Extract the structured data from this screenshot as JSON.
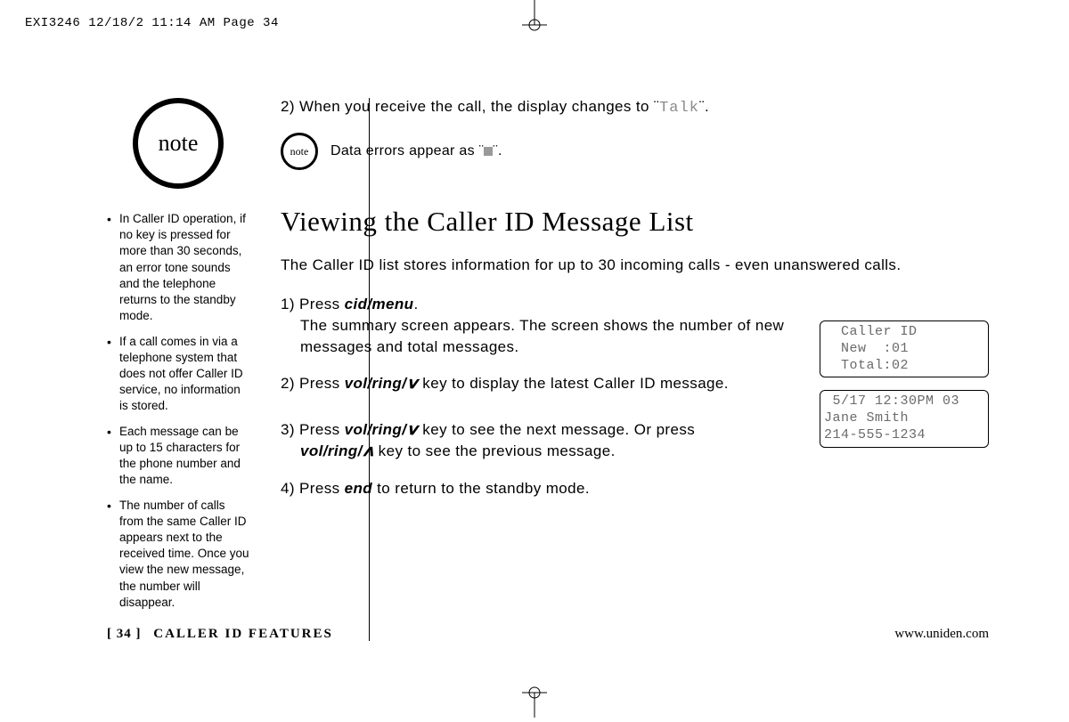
{
  "header": "EXI3246  12/18/2 11:14 AM  Page 34",
  "sidebar": {
    "note_label": "note",
    "bullets": [
      "In Caller ID operation, if no key is pressed for more than 30 seconds, an error tone sounds and the telephone returns to the standby mode.",
      "If a call comes in via a telephone system that does not offer Caller ID service, no information is stored.",
      "Each message can be up to 15 characters for the phone number and the name.",
      "The number of calls from the same Caller ID appears next to the received time. Once you view the new message, the number will disappear."
    ]
  },
  "main": {
    "line2_pre": "2) When you receive the call, the display changes to ¨",
    "line2_talk": "Talk",
    "line2_post": "¨.",
    "inline_note_label": "note",
    "data_errors_pre": "Data errors appear as ¨",
    "data_errors_post": "¨.",
    "heading": "Viewing the Caller ID Message List",
    "intro": "The Caller ID list stores information for up to 30 incoming calls - even unanswered calls.",
    "steps": {
      "s1_num": "1) Press ",
      "s1_btn": "cid/menu",
      "s1_rest": ".",
      "s1_body": "The summary screen appears. The screen shows the number of new messages and total messages.",
      "s2_num": "2) Press ",
      "s2_btn": "vol/ring/",
      "s2_rest": " key to display the latest Caller ID message.",
      "s3_num": "3) Press ",
      "s3_btn1": "vol/ring/",
      "s3_mid": " key to see the next message. Or press ",
      "s3_btn2": "vol/ring/",
      "s3_rest": " key to see the previous message.",
      "s4_num": "4) Press ",
      "s4_btn": "end",
      "s4_rest": " to return to the standby mode."
    },
    "lcd1": "  Caller ID\n  New  :01\n  Total:02",
    "lcd2": " 5/17 12:30PM 03\nJane Smith\n214-555-1234"
  },
  "footer": {
    "page": "[ 34 ]",
    "section": "CALLER ID FEATURES",
    "url": "www.uniden.com"
  }
}
